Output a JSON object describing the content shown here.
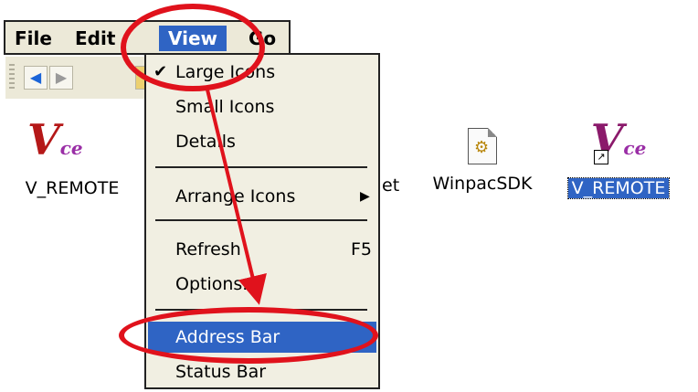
{
  "menubar": {
    "items": [
      {
        "label": "File"
      },
      {
        "label": "Edit"
      },
      {
        "label": "View"
      },
      {
        "label": "Go"
      }
    ]
  },
  "view_menu": {
    "large_icons": "Large Icons",
    "small_icons": "Small Icons",
    "details": "Details",
    "arrange_icons": "Arrange Icons",
    "refresh": "Refresh",
    "refresh_shortcut": "F5",
    "options": "Options...",
    "address_bar": "Address Bar",
    "status_bar": "Status Bar"
  },
  "desktop": {
    "icon1_label": "V_REMOTE",
    "partial_label": "et",
    "icon2_label": "WinpacSDK",
    "icon3_label": "V_REMOTE",
    "vce_text": "V",
    "vce_sub": "ce"
  },
  "colors": {
    "annotation": "#e0121c",
    "highlight": "#2f64c4"
  }
}
